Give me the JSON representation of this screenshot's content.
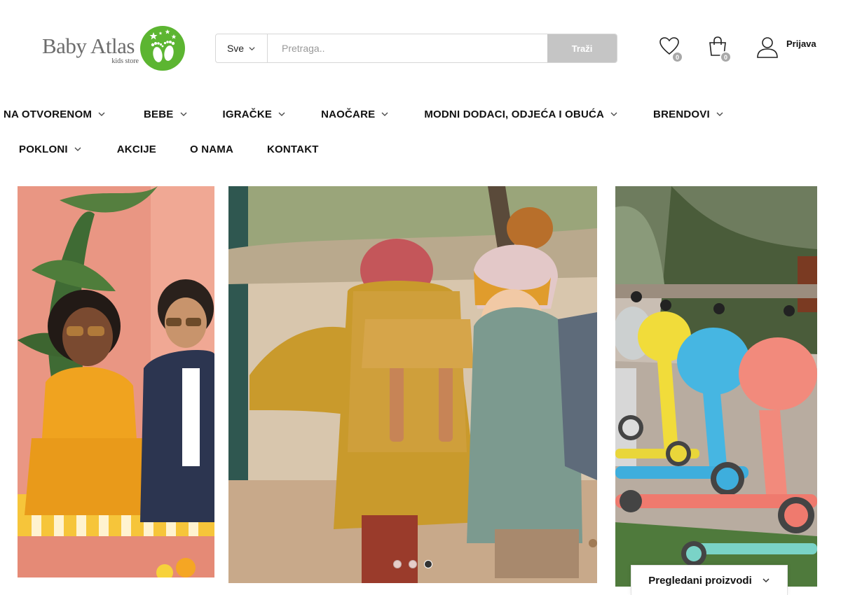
{
  "logo": {
    "name": "Baby Atlas",
    "tagline": "kids store"
  },
  "search": {
    "category": "Sve",
    "placeholder": "Pretraga..",
    "button": "Traži"
  },
  "header": {
    "wishlist_count": "0",
    "cart_count": "0",
    "login_label": "Prijava"
  },
  "nav": {
    "row1": [
      "NA OTVORENOM",
      "BEBE",
      "IGRAČKE",
      "NAOČARE",
      "MODNI DODACI, ODJEĆA I OBUĆA",
      "BRENDOVI"
    ],
    "row2": [
      "POKLONI",
      "AKCIJE",
      "O NAMA",
      "KONTAKT"
    ]
  },
  "slider": {
    "dot_count": 3,
    "active_dot": 3
  },
  "recently_viewed": {
    "label": "Pregledani proizvodi"
  },
  "colors": {
    "accent_green": "#5cb531",
    "button_gray": "#c5c5c5",
    "badge_gray": "#a8a8a8"
  }
}
